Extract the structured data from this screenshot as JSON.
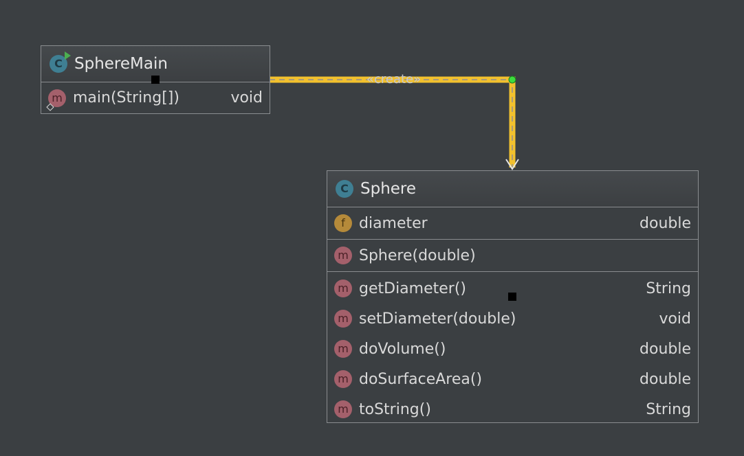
{
  "diagram": {
    "background": "#3b3f42",
    "relation": {
      "label": "«create»",
      "color": "#f2c12e",
      "junction_color": "#3ddc3d"
    },
    "classes": [
      {
        "name": "SphereMain",
        "badge": "C",
        "methods": [
          {
            "badge": "m",
            "name": "main(String[])",
            "type": "void"
          }
        ]
      },
      {
        "name": "Sphere",
        "badge": "C",
        "fields": [
          {
            "badge": "f",
            "name": "diameter",
            "type": "double"
          }
        ],
        "constructors": [
          {
            "badge": "m",
            "name": "Sphere(double)",
            "type": ""
          }
        ],
        "methods": [
          {
            "badge": "m",
            "name": "getDiameter()",
            "type": "String"
          },
          {
            "badge": "m",
            "name": "setDiameter(double)",
            "type": "void"
          },
          {
            "badge": "m",
            "name": "doVolume()",
            "type": "double"
          },
          {
            "badge": "m",
            "name": "doSurfaceArea()",
            "type": "double"
          },
          {
            "badge": "m",
            "name": "toString()",
            "type": "String"
          }
        ]
      }
    ]
  }
}
